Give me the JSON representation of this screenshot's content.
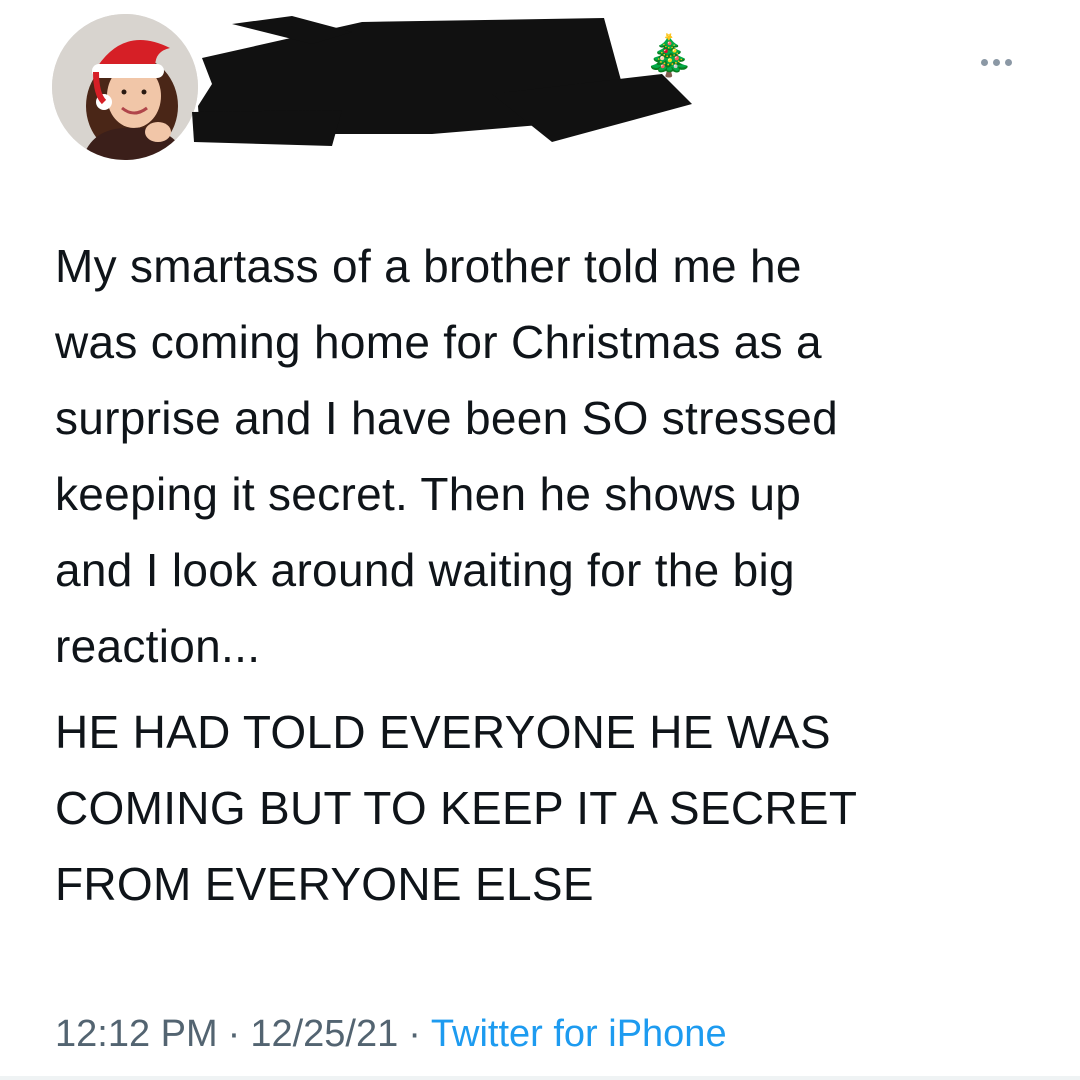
{
  "tweet": {
    "avatar_icon": "profile-photo-santa-hat",
    "name_emoji": "🎄",
    "more_icon": "more-horizontal-icon",
    "body": {
      "paragraph_1": "My smartass of a brother told me he\nwas coming home for Christmas as a\nsurprise and I have been SO stressed\nkeeping it secret. Then he shows up\nand I look around waiting for the big\nreaction...",
      "paragraph_2": "HE HAD TOLD EVERYONE HE WAS\nCOMING BUT TO KEEP IT A SECRET\nFROM EVERYONE ELSE"
    },
    "meta": {
      "time": "12:12 PM",
      "separator": "·",
      "date": "12/25/21",
      "source": "Twitter for iPhone"
    }
  },
  "colors": {
    "text": "#0f1419",
    "secondary_text": "#536471",
    "link": "#1d9bf0",
    "redaction": "#111111"
  }
}
